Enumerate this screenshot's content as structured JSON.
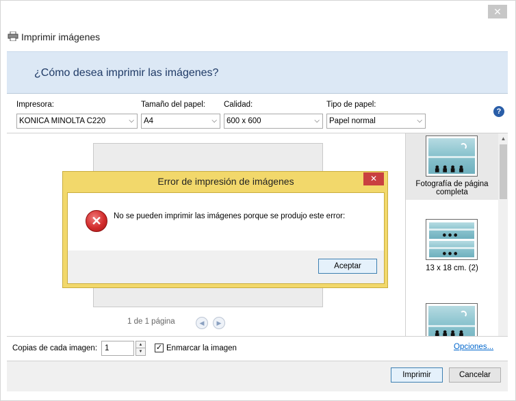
{
  "window": {
    "title": "Imprimir imágenes",
    "close_glyph": "✕"
  },
  "banner": {
    "question": "¿Cómo desea imprimir las imágenes?"
  },
  "options": {
    "printer": {
      "label": "Impresora:",
      "value": "KONICA MINOLTA C220"
    },
    "paper_size": {
      "label": "Tamaño del papel:",
      "value": "A4"
    },
    "quality": {
      "label": "Calidad:",
      "value": "600 x 600"
    },
    "paper_type": {
      "label": "Tipo de papel:",
      "value": "Papel normal"
    },
    "help_glyph": "?"
  },
  "preview": {
    "page_count": "1 de 1 página",
    "prev_glyph": "◀",
    "next_glyph": "▶"
  },
  "layouts": [
    {
      "label": "Fotografía de página completa",
      "selected": true
    },
    {
      "label": "13 x 18 cm. (2)",
      "selected": false
    },
    {
      "label": "",
      "selected": false
    }
  ],
  "bottom": {
    "copies_label": "Copias de cada imagen:",
    "copies_value": "1",
    "fit_label": "Enmarcar la imagen",
    "fit_checked": true,
    "options_link": "Opciones..."
  },
  "footer": {
    "print_label": "Imprimir",
    "cancel_label": "Cancelar"
  },
  "error_dialog": {
    "title": "Error de impresión de imágenes",
    "message": "No se pueden imprimir las imágenes porque se produjo este error:",
    "ok_label": "Aceptar",
    "close_glyph": "✕",
    "icon_glyph": "✕"
  },
  "colors": {
    "banner_bg": "#dce8f5",
    "error_frame": "#f2d86b",
    "error_close": "#c94040",
    "link": "#0066cc"
  }
}
